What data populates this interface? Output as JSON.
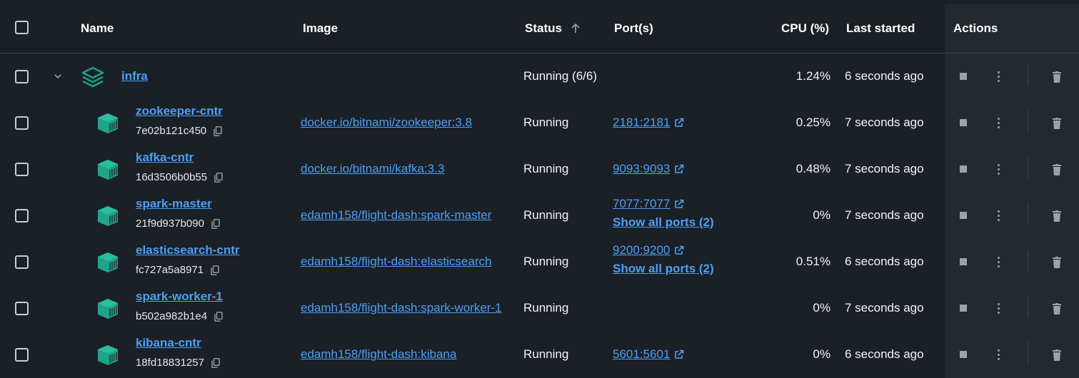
{
  "header": {
    "name": "Name",
    "image": "Image",
    "status": "Status",
    "ports": "Port(s)",
    "cpu": "CPU (%)",
    "last_started": "Last started",
    "actions": "Actions"
  },
  "group": {
    "name": "infra",
    "status": "Running (6/6)",
    "cpu": "1.24%",
    "last_started": "6 seconds ago"
  },
  "containers": [
    {
      "name": "zookeeper-cntr",
      "id": "7e02b121c450",
      "image": "docker.io/bitnami/zookeeper:3.8",
      "status": "Running",
      "port": "2181:2181",
      "more_ports": "",
      "cpu": "0.25%",
      "last_started": "7 seconds ago"
    },
    {
      "name": "kafka-cntr",
      "id": "16d3506b0b55",
      "image": "docker.io/bitnami/kafka:3.3",
      "status": "Running",
      "port": "9093:9093",
      "more_ports": "",
      "cpu": "0.48%",
      "last_started": "7 seconds ago"
    },
    {
      "name": "spark-master",
      "id": "21f9d937b090",
      "image": "edamh158/flight-dash:spark-master",
      "status": "Running",
      "port": "7077:7077",
      "more_ports": "Show all ports (2)",
      "cpu": "0%",
      "last_started": "7 seconds ago"
    },
    {
      "name": "elasticsearch-cntr",
      "id": "fc727a5a8971",
      "image": "edamh158/flight-dash:elasticsearch",
      "status": "Running",
      "port": "9200:9200",
      "more_ports": "Show all ports (2)",
      "cpu": "0.51%",
      "last_started": "6 seconds ago"
    },
    {
      "name": "spark-worker-1",
      "id": "b502a982b1e4",
      "image": "edamh158/flight-dash:spark-worker-1",
      "status": "Running",
      "port": "",
      "more_ports": "",
      "cpu": "0%",
      "last_started": "7 seconds ago"
    },
    {
      "name": "kibana-cntr",
      "id": "18fd18831257",
      "image": "edamh158/flight-dash:kibana",
      "status": "Running",
      "port": "5601:5601",
      "more_ports": "",
      "cpu": "0%",
      "last_started": "6 seconds ago"
    }
  ],
  "icons": {
    "sort": "arrow-up-icon",
    "expand": "chevron-down-icon",
    "group": "stack-layers-icon",
    "container": "container-icon",
    "copy": "copy-icon",
    "external": "external-link-icon",
    "stop": "stop-icon",
    "more": "more-vertical-icon",
    "delete": "trash-icon"
  },
  "colors": {
    "background": "#1b2026",
    "actions_column": "#22292f",
    "link": "#4c9ff5",
    "container_icon": "#1fa389"
  }
}
